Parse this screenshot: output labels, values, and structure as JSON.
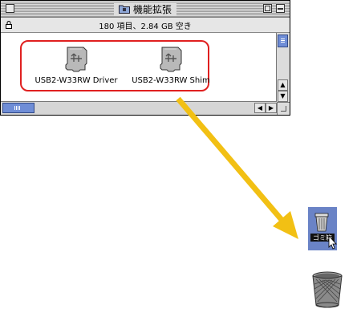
{
  "window": {
    "title": "機能拡張",
    "info": "180 項目、2.84 GB 空き"
  },
  "items": [
    {
      "label": "USB2-W33RW Driver"
    },
    {
      "label": "USB2-W33RW Shim"
    }
  ],
  "icons": {
    "folder": "extensions-folder-icon",
    "lock": "lock-icon",
    "item": "usb-extension-icon",
    "trash_active": "trash-full-icon",
    "trash": "trash-icon"
  },
  "trash_label": "ゴミ箱",
  "colors": {
    "highlight": "#e02020",
    "arrow": "#f2c014",
    "scroll_thumb": "#6f8dd6"
  }
}
